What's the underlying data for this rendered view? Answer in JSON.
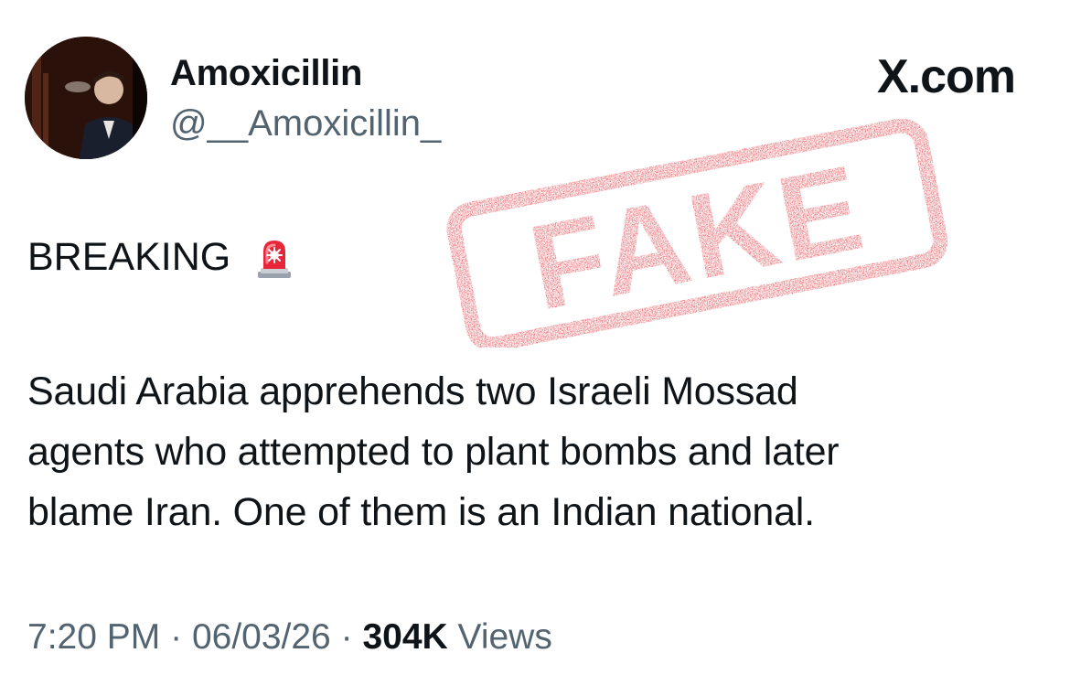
{
  "tweet": {
    "display_name": "Amoxicillin",
    "handle": "@__Amoxicillin_",
    "brand": "X.com",
    "breaking": "BREAKING",
    "siren_icon": "police-car-light-icon",
    "body_lines": [
      "Saudi Arabia apprehends two Israeli Mossad",
      "agents who attempted to plant bombs and later",
      "blame Iran. One of them is an Indian national."
    ],
    "time": "7:20 PM",
    "separator": "·",
    "date": "06/03/26",
    "views_count": "304K",
    "views_label": "Views"
  },
  "stamp": {
    "text": "FAKE",
    "color": "#e0303a"
  },
  "colors": {
    "text": "#0f1419",
    "secondary": "#536471",
    "background": "#ffffff"
  }
}
